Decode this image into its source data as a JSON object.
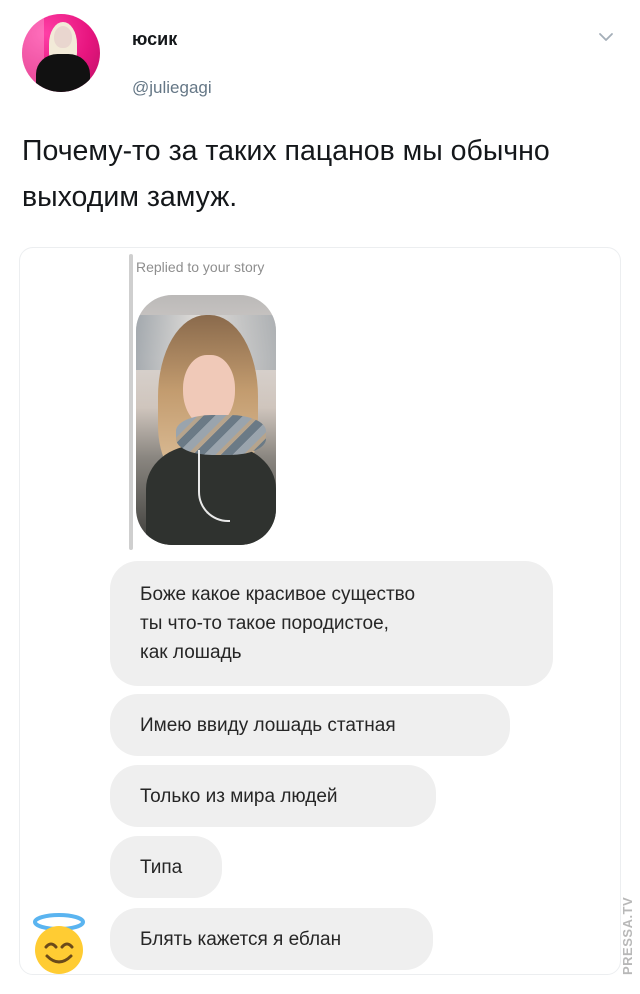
{
  "tweet": {
    "display_name": "юсик",
    "handle": "@juliegagi",
    "text": "Почему-то за таких пацанов мы обычно выходим замуж.",
    "chevron_icon": "chevron-down-icon"
  },
  "dm_screenshot": {
    "reply_label": "Replied to your story",
    "messages": [
      "Боже какое красивое существо\nты что-то такое породистое,\nкак лошадь",
      "Имею ввиду лошадь статная",
      "Только из мира людей",
      "Типа",
      "Блять кажется я еблан"
    ],
    "sender_avatar_icon": "smiling-face-with-halo-icon",
    "bubble_color": "#efefef"
  },
  "watermark": "PRESSA.TV",
  "colors": {
    "avatar_bg": "#e7157f",
    "handle": "#657786",
    "text": "#14171a"
  }
}
